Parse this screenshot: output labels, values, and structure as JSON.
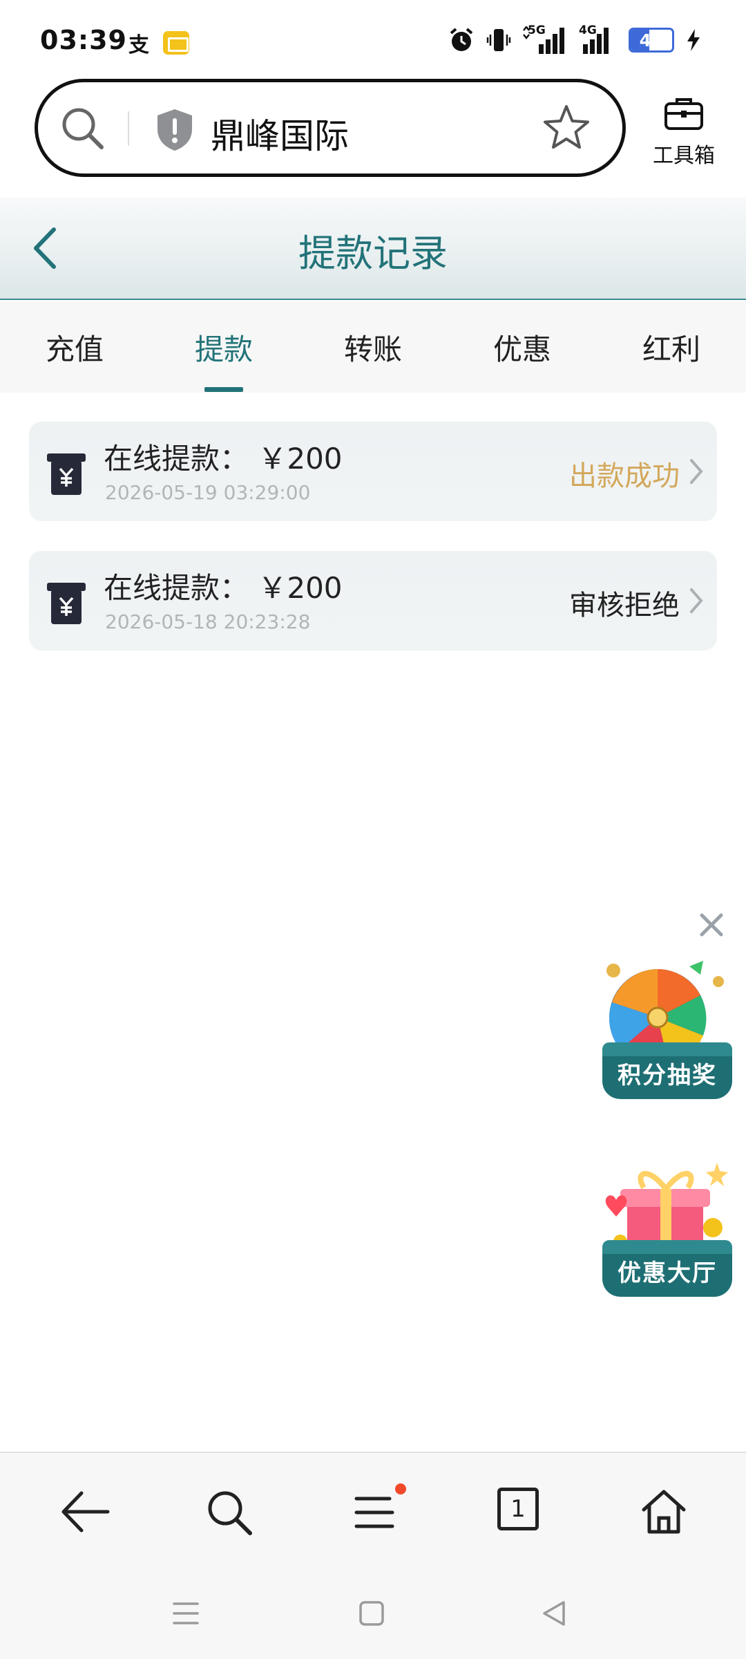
{
  "status_bar": {
    "time": "03:39",
    "app_icons": [
      "alipay-icon",
      "mail-icon"
    ],
    "right_icons": [
      "alarm-icon",
      "vibrate-icon",
      "signal-5g-icon",
      "signal-4g-icon"
    ],
    "network_5g": "5G",
    "network_4g": "4G",
    "battery_level": "45",
    "battery_fraction": 0.45,
    "battery_color": "#3d6ad8"
  },
  "browser": {
    "url_text": "鼎峰国际",
    "toolbox_label": "工具箱"
  },
  "header": {
    "title": "提款记录",
    "accent_color": "#227379"
  },
  "tabs": [
    {
      "label": "充值",
      "active": false
    },
    {
      "label": "提款",
      "active": true
    },
    {
      "label": "转账",
      "active": false
    },
    {
      "label": "优惠",
      "active": false
    },
    {
      "label": "红利",
      "active": false
    }
  ],
  "records": [
    {
      "title": "在线提款： ￥200",
      "time": "2026-05-19 03:29:00",
      "status": "出款成功",
      "status_type": "success"
    },
    {
      "title": "在线提款： ￥200",
      "time": "2026-05-18 20:23:28",
      "status": "审核拒绝",
      "status_type": "rejected"
    }
  ],
  "promos": [
    {
      "label": "积分抽奖",
      "icon": "prize-wheel-icon"
    },
    {
      "label": "优惠大厅",
      "icon": "gift-box-icon"
    }
  ],
  "bottom_nav": {
    "tabs_count": "1",
    "icons": [
      "back-arrow-icon",
      "search-icon",
      "menu-icon",
      "tabs-icon",
      "home-icon"
    ]
  }
}
